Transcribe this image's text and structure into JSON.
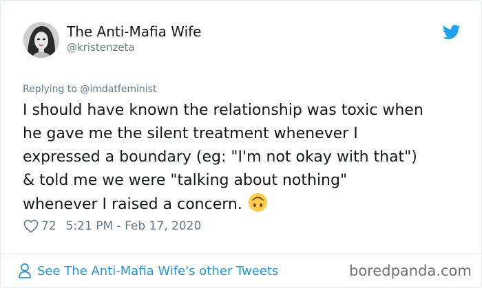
{
  "author": {
    "display_name": "The Anti-Mafia Wife",
    "handle": "@kristenzeta"
  },
  "tweet": {
    "replying_to": "Replying to @imdatfeminist",
    "text": "I should have known the relationship was toxic when\nhe gave me the silent treatment whenever I\nexpressed a boundary (eg: \"I'm not okay with that\")\n& told me we were \"talking about nothing\"\nwhenever I raised a concern.",
    "emoji": "upside-down-face",
    "likes": "72",
    "timestamp": "5:21 PM - Feb 17, 2020"
  },
  "footer": {
    "see_more": "See The Anti-Mafia Wife's other Tweets"
  },
  "watermark": "boredpanda.com",
  "colors": {
    "twitter_blue": "#1da1f2",
    "link_blue": "#1b95e0",
    "muted_gray": "#657786",
    "emoji_yellow": "#ffcc4d"
  },
  "icons": {
    "brand": "twitter-bird-icon",
    "like": "heart-icon",
    "profile": "person-icon"
  }
}
